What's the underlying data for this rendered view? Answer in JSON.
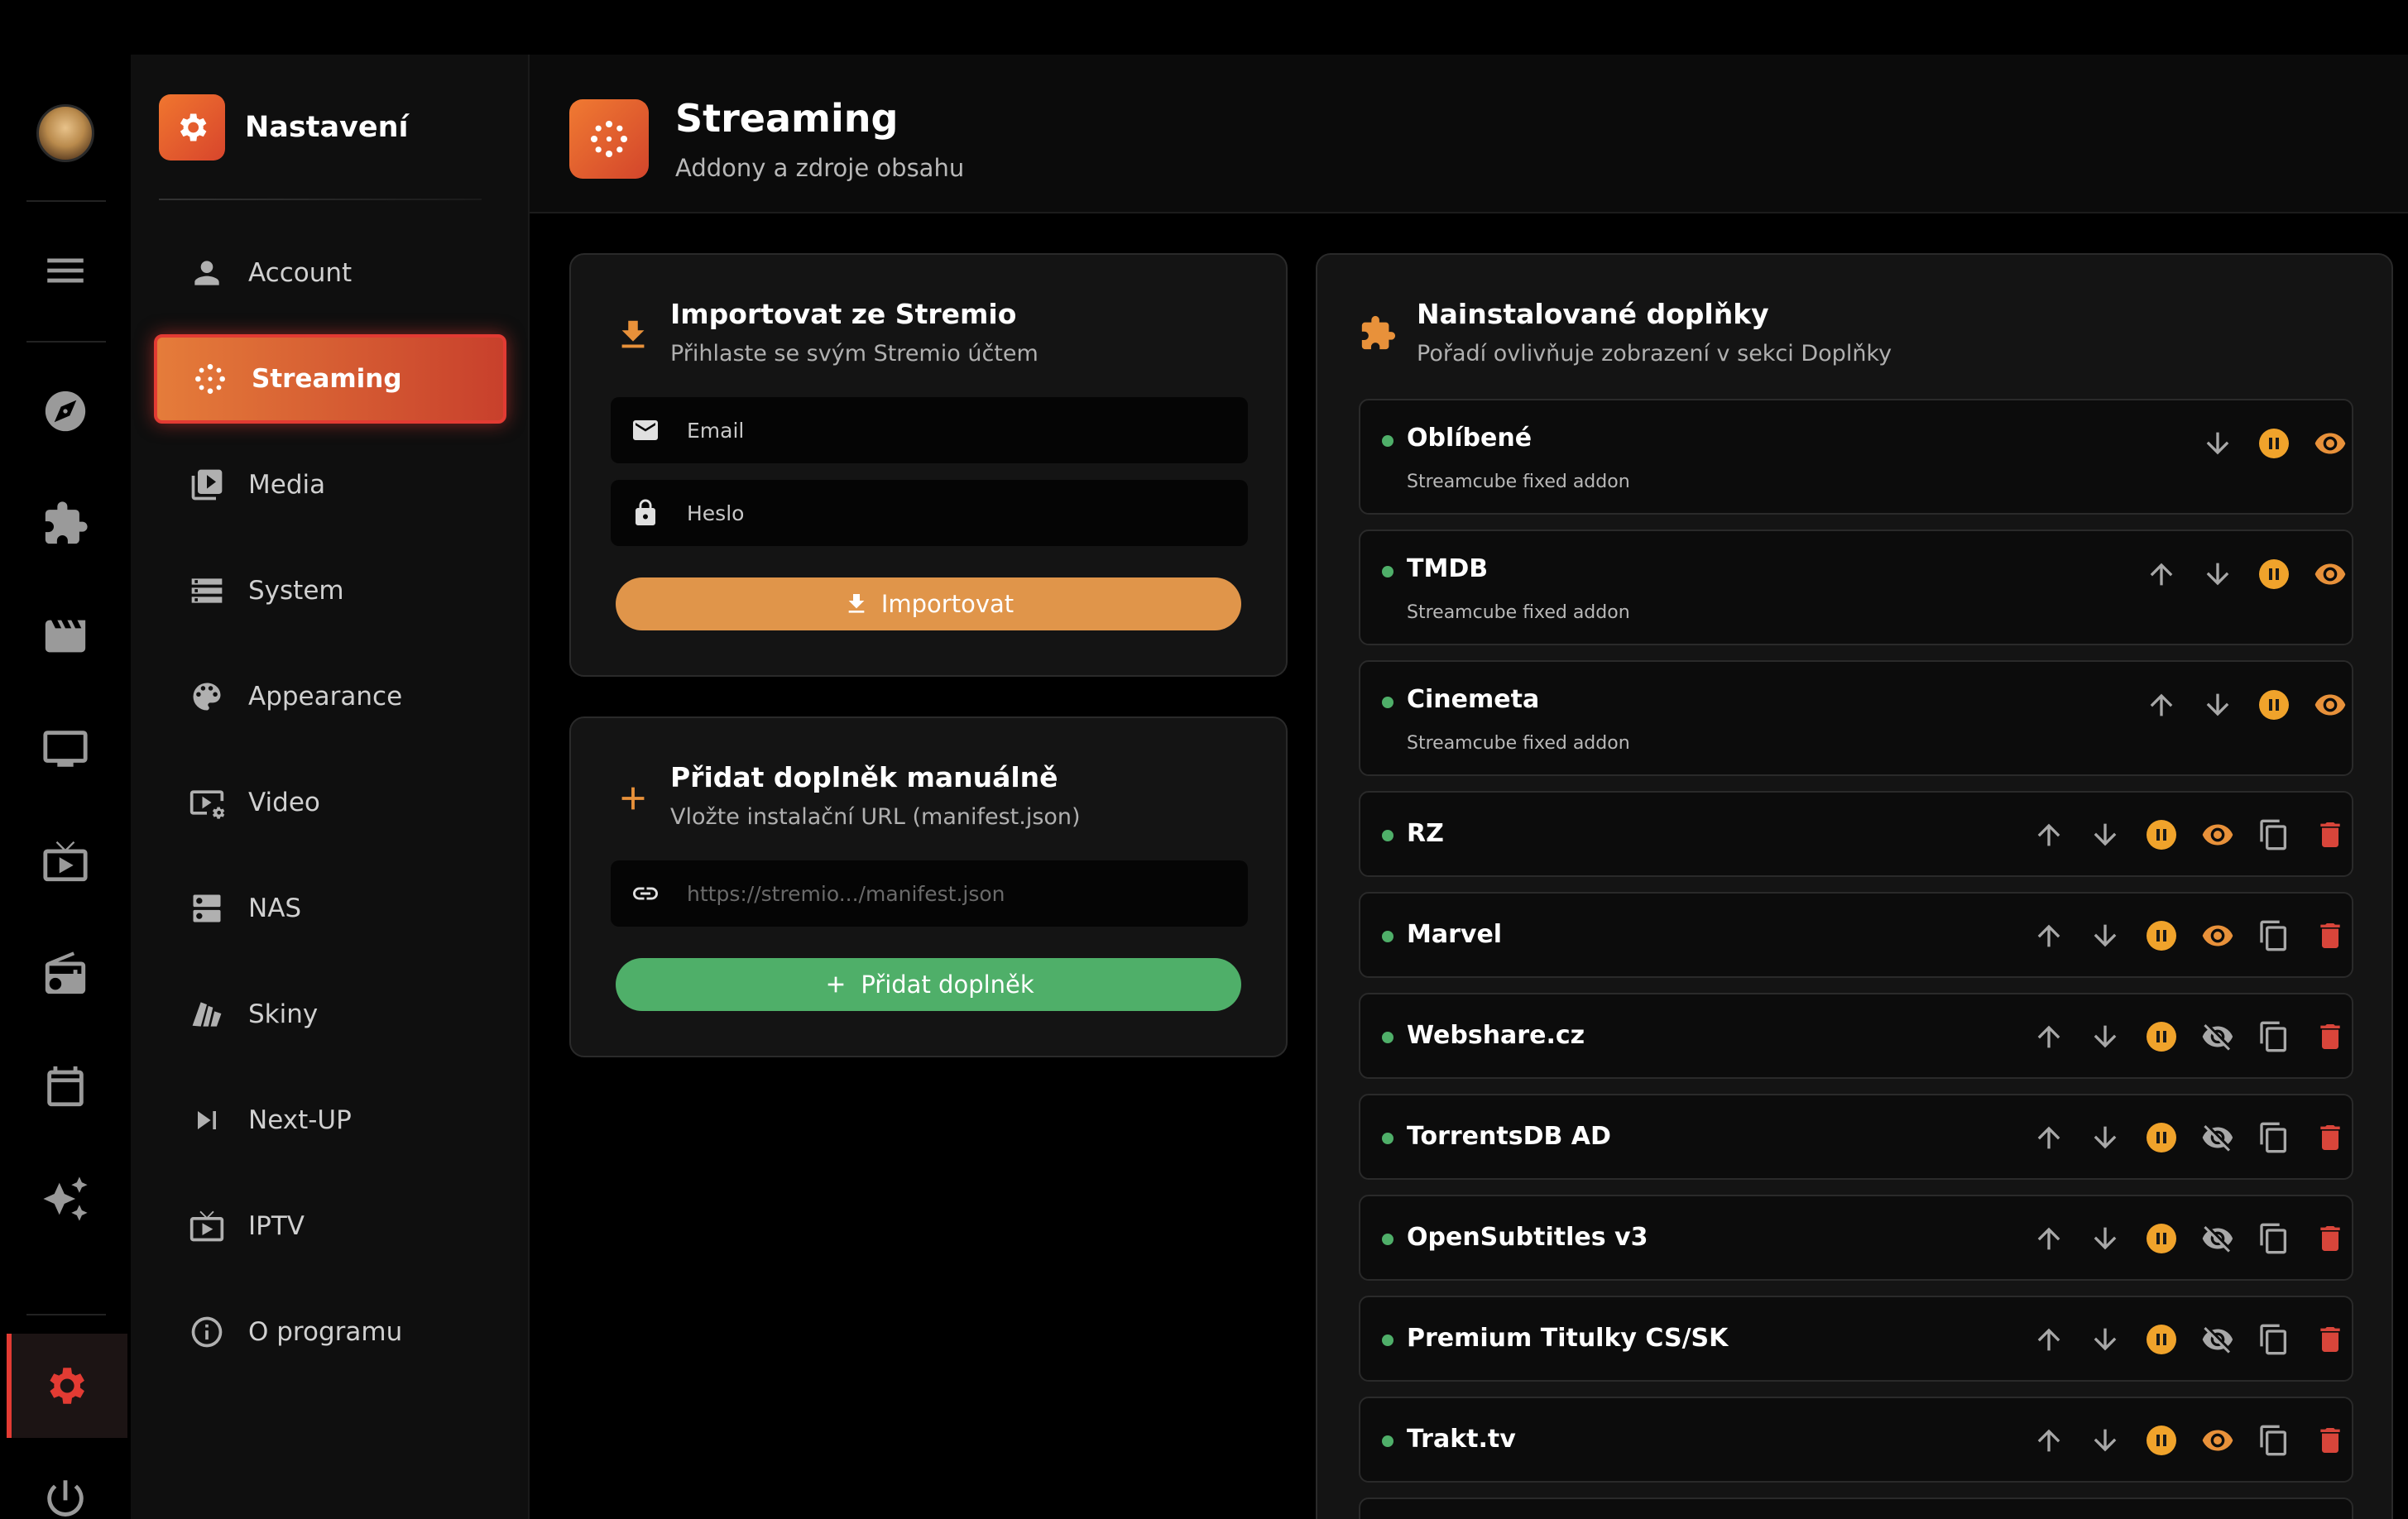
{
  "sidebar": {
    "title": "Nastavení",
    "items": [
      {
        "label": "Account",
        "icon": "person-icon"
      },
      {
        "label": "Streaming",
        "icon": "streaming-icon"
      },
      {
        "label": "Media",
        "icon": "media-icon"
      },
      {
        "label": "System",
        "icon": "system-icon"
      },
      {
        "label": "Appearance",
        "icon": "palette-icon"
      },
      {
        "label": "Video",
        "icon": "video-settings-icon"
      },
      {
        "label": "NAS",
        "icon": "storage-icon"
      },
      {
        "label": "Skiny",
        "icon": "skins-icon"
      },
      {
        "label": "Next-UP",
        "icon": "skip-next-icon"
      },
      {
        "label": "IPTV",
        "icon": "live-tv-icon"
      },
      {
        "label": "O programu",
        "icon": "info-icon"
      }
    ]
  },
  "header": {
    "title": "Streaming",
    "subtitle": "Addony a zdroje obsahu"
  },
  "import_card": {
    "title": "Importovat ze Stremio",
    "subtitle": "Přihlaste se svým Stremio účtem",
    "email_label": "Email",
    "password_label": "Heslo",
    "button_label": "Importovat"
  },
  "manual_card": {
    "title": "Přidat doplněk manuálně",
    "subtitle": "Vložte instalační URL (manifest.json)",
    "url_placeholder": "https://stremio.../manifest.json",
    "button_label": "Přidat doplněk"
  },
  "installed": {
    "title": "Nainstalované doplňky",
    "subtitle": "Pořadí ovlivňuje zobrazení v sekci Doplňky",
    "addons": [
      {
        "name": "Oblíbené",
        "description": "Streamcube fixed addon",
        "visible": true
      },
      {
        "name": "TMDB",
        "description": "Streamcube fixed addon",
        "visible": true
      },
      {
        "name": "Cinemeta",
        "description": "Streamcube fixed addon",
        "visible": true
      },
      {
        "name": "RZ",
        "visible": true
      },
      {
        "name": "Marvel",
        "visible": true
      },
      {
        "name": "Webshare.cz",
        "visible": false
      },
      {
        "name": "TorrentsDB AD",
        "visible": false
      },
      {
        "name": "OpenSubtitles v3",
        "visible": false
      },
      {
        "name": "Premium Titulky CS/SK",
        "visible": false
      },
      {
        "name": "Trakt.tv",
        "visible": true
      }
    ]
  },
  "colors": {
    "accent": "#e8913a",
    "active": "#e23b33",
    "green": "#4faf69",
    "danger": "#d8453a"
  }
}
